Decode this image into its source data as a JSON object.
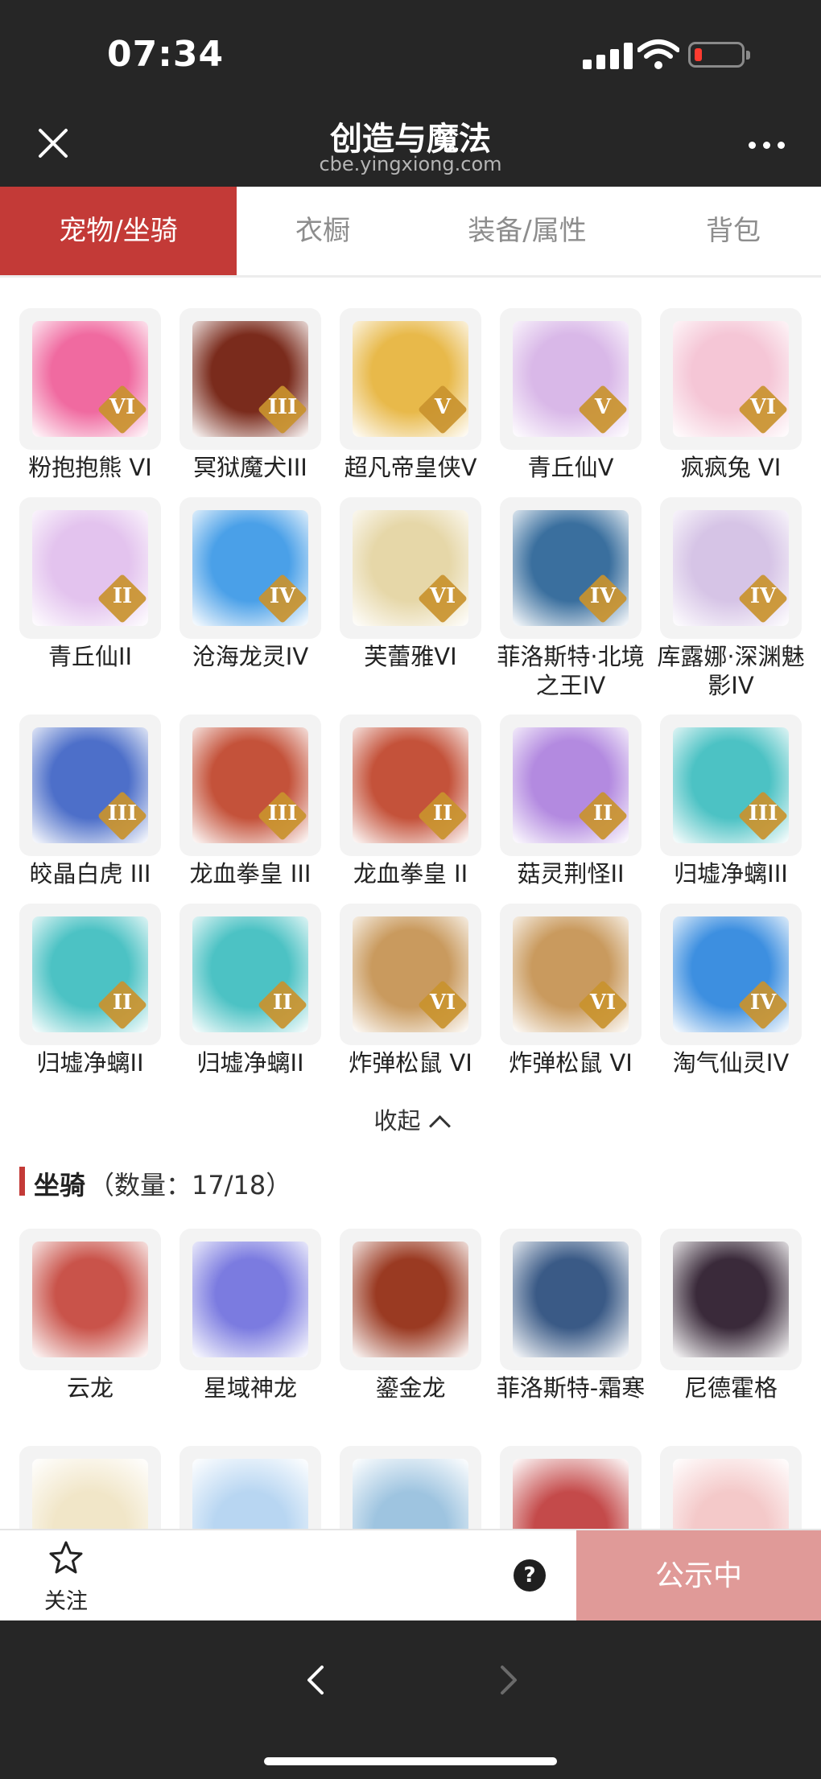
{
  "status": {
    "time": "07:34"
  },
  "header": {
    "title": "创造与魔法",
    "subtitle": "cbe.yingxiong.com",
    "close_icon": "close-icon",
    "more_icon": "more-icon"
  },
  "tabs": [
    {
      "label": "宠物/坐骑",
      "active": true
    },
    {
      "label": "衣橱",
      "active": false
    },
    {
      "label": "装备/属性",
      "active": false
    },
    {
      "label": "背包",
      "active": false
    }
  ],
  "pets": [
    {
      "name": "粉抱抱熊 VI",
      "tier": "VI",
      "color": "#f06aa0"
    },
    {
      "name": "冥狱魔犬III",
      "tier": "III",
      "color": "#7a2b1c"
    },
    {
      "name": "超凡帝皇侠V",
      "tier": "V",
      "color": "#e8b94a"
    },
    {
      "name": "青丘仙V",
      "tier": "V",
      "color": "#d9b8e8"
    },
    {
      "name": "疯疯兔 VI",
      "tier": "VI",
      "color": "#f5c6d6"
    },
    {
      "name": "青丘仙II",
      "tier": "II",
      "color": "#e3c3ee"
    },
    {
      "name": "沧海龙灵IV",
      "tier": "IV",
      "color": "#4aa0e8"
    },
    {
      "name": "芙蕾雅VI",
      "tier": "VI",
      "color": "#e6d7a8"
    },
    {
      "name": "菲洛斯特·北境之王IV",
      "tier": "IV",
      "color": "#3a6f9e"
    },
    {
      "name": "库露娜·深渊魅影IV",
      "tier": "IV",
      "color": "#d6c4e6"
    },
    {
      "name": "皎晶白虎 III",
      "tier": "III",
      "color": "#4d6fc9"
    },
    {
      "name": "龙血拳皇 III",
      "tier": "III",
      "color": "#c4523a"
    },
    {
      "name": "龙血拳皇 II",
      "tier": "II",
      "color": "#c4523a"
    },
    {
      "name": "菇灵荆怪II",
      "tier": "II",
      "color": "#b38ae0"
    },
    {
      "name": "归墟净螭III",
      "tier": "III",
      "color": "#4cc2c4"
    },
    {
      "name": "归墟净螭II",
      "tier": "II",
      "color": "#4cc2c4"
    },
    {
      "name": "归墟净螭II",
      "tier": "II",
      "color": "#4cc2c4"
    },
    {
      "name": "炸弹松鼠 VI",
      "tier": "VI",
      "color": "#c99a5e"
    },
    {
      "name": "炸弹松鼠 VI",
      "tier": "VI",
      "color": "#c99a5e"
    },
    {
      "name": "淘气仙灵IV",
      "tier": "IV",
      "color": "#3d8fe0"
    }
  ],
  "collapse_label": "收起",
  "mounts_section": {
    "name": "坐骑",
    "count": "（数量：17/18）"
  },
  "mounts": [
    {
      "name": "云龙",
      "color": "#c9534a"
    },
    {
      "name": "星域神龙",
      "color": "#7b7be0"
    },
    {
      "name": "鎏金龙",
      "color": "#9a3a22"
    },
    {
      "name": "菲洛斯特-霜寒",
      "color": "#3a5a86"
    },
    {
      "name": "尼德霍格",
      "color": "#3a2a3a"
    }
  ],
  "mounts_partial": [
    {
      "color": "#f1e6c8"
    },
    {
      "color": "#b8d6f2"
    },
    {
      "color": "#9ec4e0"
    },
    {
      "color": "#c44a4a"
    },
    {
      "color": "#f4c9c9"
    }
  ],
  "actions": {
    "follow_label": "关注",
    "help_icon": "?",
    "public_label": "公示中"
  },
  "colors": {
    "accent": "#c33a37",
    "public_button": "#e09a98",
    "dark_bar": "#262626"
  }
}
